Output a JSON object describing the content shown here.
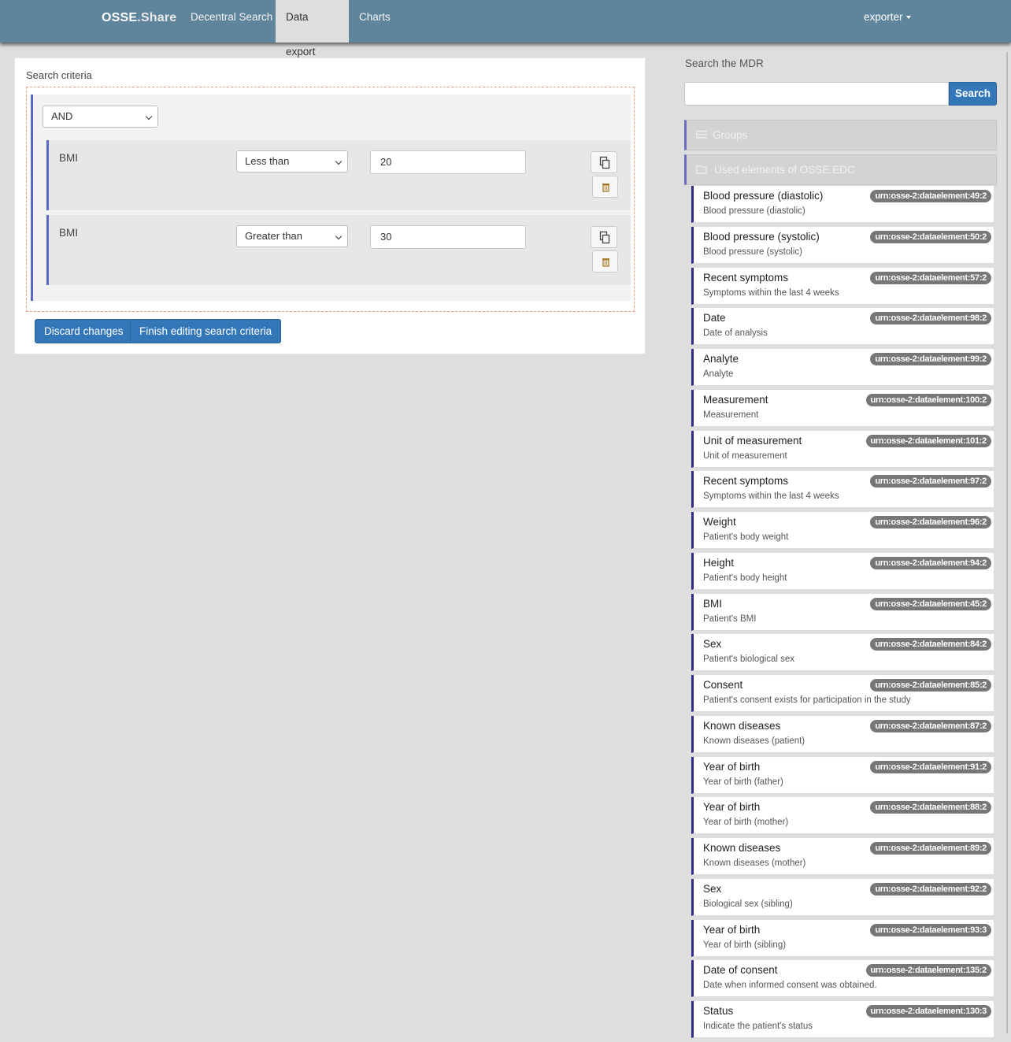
{
  "navbar": {
    "brand_part1": "OSSE",
    "brand_part2": ".Share",
    "tabs": [
      {
        "label": "Decentral Search"
      },
      {
        "label": "Data export"
      },
      {
        "label": "Charts"
      }
    ],
    "active_tab": "Data export",
    "user": "exporter"
  },
  "criteria_panel": {
    "title": "Search criteria",
    "group_operator": "AND",
    "criteria": [
      {
        "name": "BMI",
        "operator": "Less than",
        "value": "20"
      },
      {
        "name": "BMI",
        "operator": "Greater than",
        "value": "30"
      }
    ],
    "discard_label": "Discard changes",
    "finish_label": "Finish editing search criteria"
  },
  "mdr": {
    "title": "Search the MDR",
    "search_value": "",
    "search_button": "Search",
    "groups_label": "Groups",
    "used_elements_label": "Used elements of OSSE.EDC",
    "elements": [
      {
        "name": "Blood pressure (diastolic)",
        "desc": "Blood pressure (diastolic)",
        "urn": "urn:osse-2:dataelement:49:2"
      },
      {
        "name": "Blood pressure (systolic)",
        "desc": "Blood pressure (systolic)",
        "urn": "urn:osse-2:dataelement:50:2"
      },
      {
        "name": "Recent symptoms",
        "desc": "Symptoms within the last 4 weeks",
        "urn": "urn:osse-2:dataelement:57:2"
      },
      {
        "name": "Date",
        "desc": "Date of analysis",
        "urn": "urn:osse-2:dataelement:98:2"
      },
      {
        "name": "Analyte",
        "desc": "Analyte",
        "urn": "urn:osse-2:dataelement:99:2"
      },
      {
        "name": "Measurement",
        "desc": "Measurement",
        "urn": "urn:osse-2:dataelement:100:2"
      },
      {
        "name": "Unit of measurement",
        "desc": "Unit of measurement",
        "urn": "urn:osse-2:dataelement:101:2"
      },
      {
        "name": "Recent symptoms",
        "desc": "Symptoms within the last 4 weeks",
        "urn": "urn:osse-2:dataelement:97:2"
      },
      {
        "name": "Weight",
        "desc": "Patient's body weight",
        "urn": "urn:osse-2:dataelement:96:2"
      },
      {
        "name": "Height",
        "desc": "Patient's body height",
        "urn": "urn:osse-2:dataelement:94:2"
      },
      {
        "name": "BMI",
        "desc": "Patient's BMI",
        "urn": "urn:osse-2:dataelement:45:2"
      },
      {
        "name": "Sex",
        "desc": "Patient's biological sex",
        "urn": "urn:osse-2:dataelement:84:2"
      },
      {
        "name": "Consent",
        "desc": "Patient's consent exists for participation in the study",
        "urn": "urn:osse-2:dataelement:85:2"
      },
      {
        "name": "Known diseases",
        "desc": "Known diseases (patient)",
        "urn": "urn:osse-2:dataelement:87:2"
      },
      {
        "name": "Year of birth",
        "desc": "Year of birth (father)",
        "urn": "urn:osse-2:dataelement:91:2"
      },
      {
        "name": "Year of birth",
        "desc": "Year of birth (mother)",
        "urn": "urn:osse-2:dataelement:88:2"
      },
      {
        "name": "Known diseases",
        "desc": "Known diseases (mother)",
        "urn": "urn:osse-2:dataelement:89:2"
      },
      {
        "name": "Sex",
        "desc": "Biological sex (sibling)",
        "urn": "urn:osse-2:dataelement:92:2"
      },
      {
        "name": "Year of birth",
        "desc": "Year of birth (sibling)",
        "urn": "urn:osse-2:dataelement:93:3"
      },
      {
        "name": "Date of consent",
        "desc": "Date when informed consent was obtained.",
        "urn": "urn:osse-2:dataelement:135:2"
      },
      {
        "name": "Status",
        "desc": "Indicate the patient's status",
        "urn": "urn:osse-2:dataelement:130:3"
      }
    ]
  },
  "colors": {
    "navbar": "#5f859d",
    "primary": "#3377b8",
    "group_border": "#5a67c8",
    "element_border": "#2f2c8c",
    "urn_badge": "#777777"
  }
}
